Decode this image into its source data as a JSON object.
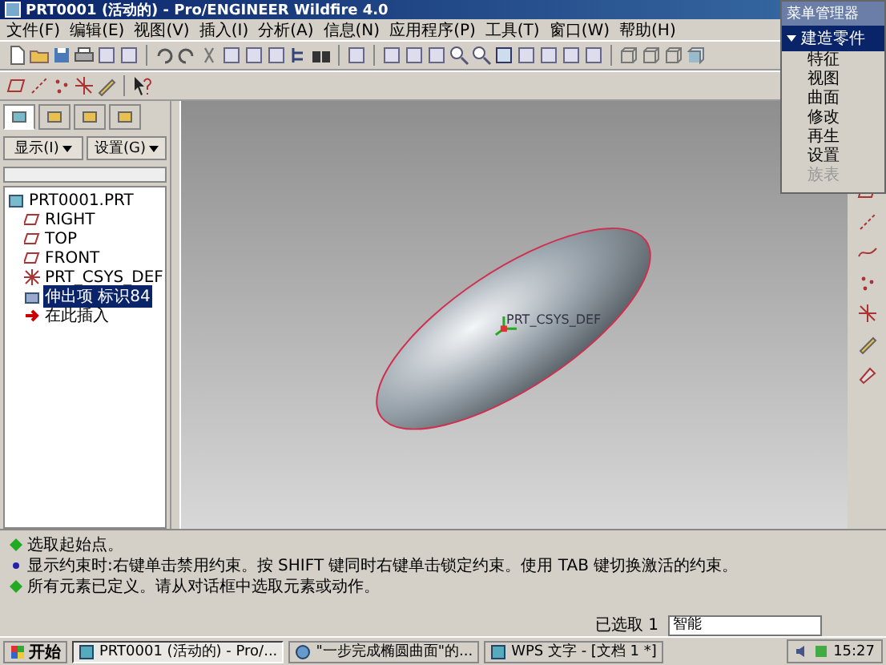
{
  "window": {
    "title": "PRT0001 (活动的) - Pro/ENGINEER Wildfire 4.0"
  },
  "menu_bar": [
    "文件(F)",
    "编辑(E)",
    "视图(V)",
    "插入(I)",
    "分析(A)",
    "信息(N)",
    "应用程序(P)",
    "工具(T)",
    "窗口(W)",
    "帮助(H)"
  ],
  "navigator": {
    "tabs": [
      {
        "selected": true
      },
      {
        "selected": false
      },
      {
        "selected": false
      },
      {
        "selected": false
      }
    ],
    "buttons": [
      "显示(I)",
      "设置(G)"
    ],
    "model_tree": [
      {
        "label": "PRT0001.PRT",
        "kind": "part",
        "selected": false,
        "children": [
          {
            "label": "RIGHT",
            "kind": "plane",
            "selected": false
          },
          {
            "label": "TOP",
            "kind": "plane",
            "selected": false
          },
          {
            "label": "FRONT",
            "kind": "plane",
            "selected": false
          },
          {
            "label": "PRT_CSYS_DEF",
            "kind": "csys",
            "selected": false
          },
          {
            "label": "伸出项 标识84",
            "kind": "feature",
            "selected": true
          },
          {
            "label": "在此插入",
            "kind": "insert",
            "selected": false
          }
        ]
      }
    ]
  },
  "graphics": {
    "csys_label": "PRT_CSYS_DEF"
  },
  "menu_manager": {
    "title": "菜单管理器",
    "section": "建造零件",
    "items": [
      {
        "label": "特征",
        "disabled": false
      },
      {
        "label": "视图",
        "disabled": false
      },
      {
        "label": "曲面",
        "disabled": false
      },
      {
        "label": "修改",
        "disabled": false
      },
      {
        "label": "再生",
        "disabled": false
      },
      {
        "label": "设置",
        "disabled": false
      },
      {
        "label": "族表",
        "disabled": true
      }
    ]
  },
  "messages": [
    {
      "kind": "prompt",
      "text": "选取起始点。"
    },
    {
      "kind": "info",
      "text": "显示约束时:右键单击禁用约束。按 SHIFT 键同时右键单击锁定约束。使用 TAB 键切换激活的约束。"
    },
    {
      "kind": "prompt",
      "text": "所有元素已定义。请从对话框中选取元素或动作。"
    }
  ],
  "status_bar": {
    "selection": "已选取 1",
    "filter": "智能"
  },
  "taskbar": {
    "start": "开始",
    "tasks": [
      {
        "label": "PRT0001 (活动的) - Pro/...",
        "kind": "app",
        "selected": true
      },
      {
        "label": "\"一步完成椭圆曲面\"的...",
        "kind": "browser",
        "selected": false
      },
      {
        "label": "WPS 文字 - [文档 1 *]",
        "kind": "app",
        "selected": false
      }
    ],
    "clock": "15:27"
  }
}
